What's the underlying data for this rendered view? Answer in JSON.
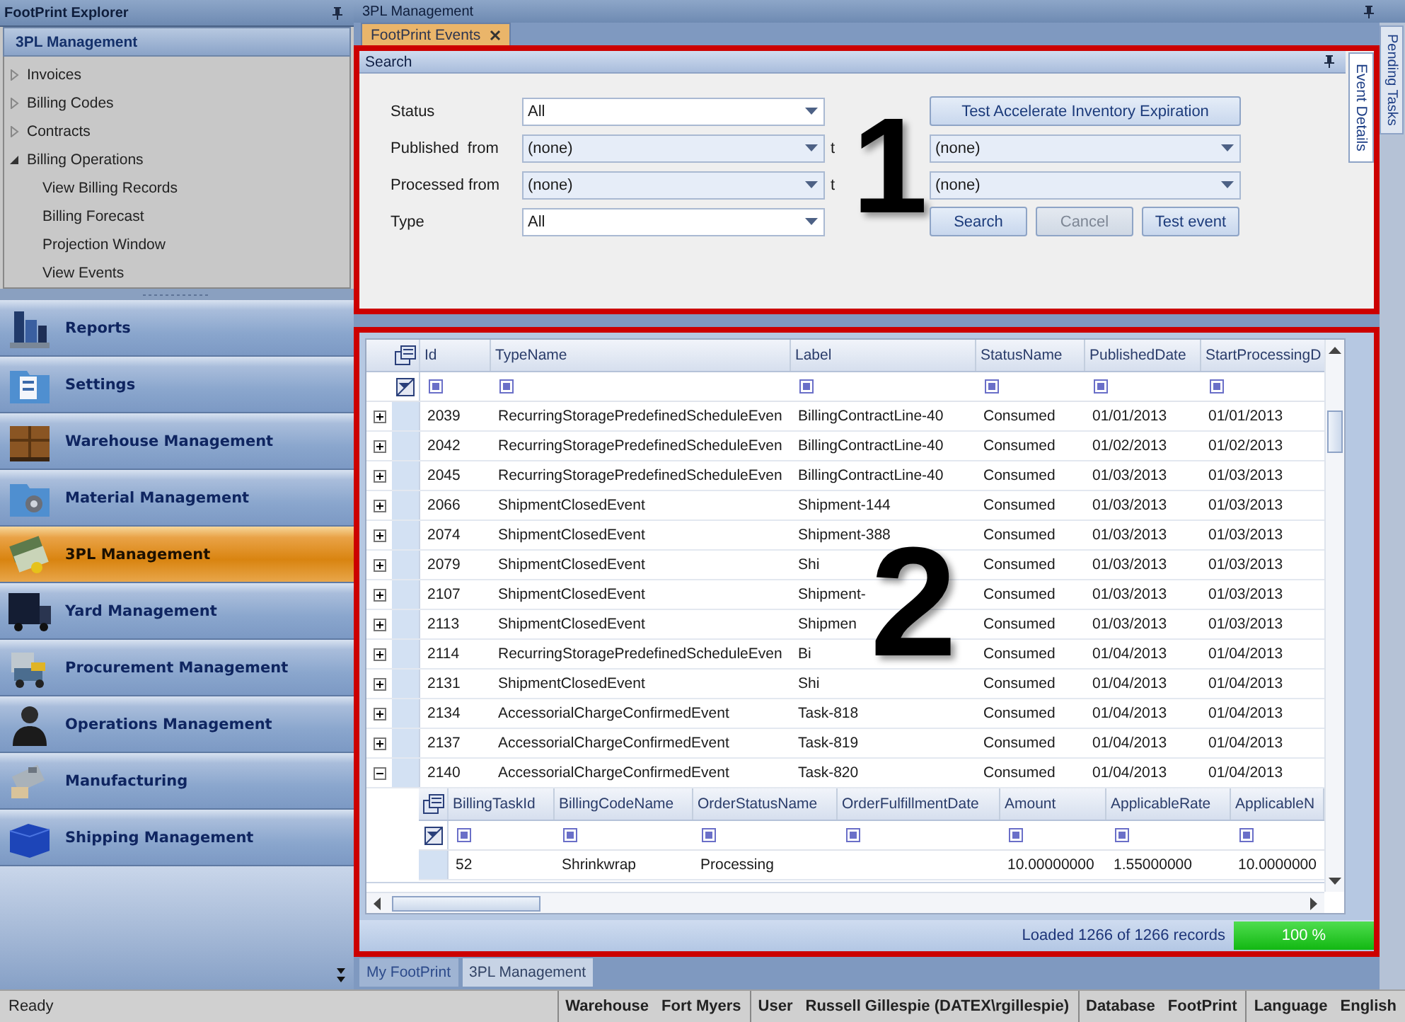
{
  "explorer": {
    "title": "FootPrint Explorer",
    "section": "3PL Management",
    "tree": [
      {
        "label": "Invoices",
        "expanded": false
      },
      {
        "label": "Billing Codes",
        "expanded": false
      },
      {
        "label": "Contracts",
        "expanded": false
      },
      {
        "label": "Billing Operations",
        "expanded": true,
        "children": [
          {
            "label": "View Billing Records"
          },
          {
            "label": "Billing Forecast"
          },
          {
            "label": "Projection Window"
          },
          {
            "label": "View Events"
          }
        ]
      }
    ]
  },
  "nav": [
    {
      "label": "Reports",
      "selected": false
    },
    {
      "label": "Settings",
      "selected": false
    },
    {
      "label": "Warehouse Management",
      "selected": false
    },
    {
      "label": "Material Management",
      "selected": false
    },
    {
      "label": "3PL Management",
      "selected": true
    },
    {
      "label": "Yard Management",
      "selected": false
    },
    {
      "label": "Procurement Management",
      "selected": false
    },
    {
      "label": "Operations Management",
      "selected": false
    },
    {
      "label": "Manufacturing",
      "selected": false
    },
    {
      "label": "Shipping Management",
      "selected": false
    }
  ],
  "document": {
    "title": "3PL Management",
    "tabs": [
      {
        "label": "FootPrint Events",
        "selected": true,
        "closable": true
      }
    ]
  },
  "side_tab": "Pending Tasks",
  "panel_tab": "Event Details",
  "search": {
    "title": "Search",
    "status": {
      "label": "Status",
      "value": "All"
    },
    "published": {
      "label": "Published  from",
      "from": "(none)",
      "to_label": "t",
      "to": "(none)"
    },
    "processed": {
      "label": "Processed from",
      "from": "(none)",
      "to_label": "t",
      "to": "(none)"
    },
    "type": {
      "label": "Type",
      "value": "All"
    },
    "test_button": {
      "label": "Test Accelerate Inventory Expiration",
      "disabled": false
    },
    "buttons": [
      {
        "label": "Search",
        "disabled": false
      },
      {
        "label": "Cancel",
        "disabled": true
      },
      {
        "label": "Test event",
        "disabled": false
      }
    ]
  },
  "callouts": [
    "1",
    "2"
  ],
  "grid": {
    "columns": [
      "Id",
      "TypeName",
      "Label",
      "StatusName",
      "PublishedDate",
      "StartProcessingD"
    ],
    "rows": [
      {
        "expanded": false,
        "cells": [
          "2039",
          "RecurringStoragePredefinedScheduleEven",
          "BillingContractLine-40",
          "Consumed",
          "01/01/2013",
          "01/01/2013"
        ]
      },
      {
        "expanded": false,
        "cells": [
          "2042",
          "RecurringStoragePredefinedScheduleEven",
          "BillingContractLine-40",
          "Consumed",
          "01/02/2013",
          "01/02/2013"
        ]
      },
      {
        "expanded": false,
        "cells": [
          "2045",
          "RecurringStoragePredefinedScheduleEven",
          "BillingContractLine-40",
          "Consumed",
          "01/03/2013",
          "01/03/2013"
        ]
      },
      {
        "expanded": false,
        "cells": [
          "2066",
          "ShipmentClosedEvent",
          "Shipment-144",
          "Consumed",
          "01/03/2013",
          "01/03/2013"
        ]
      },
      {
        "expanded": false,
        "cells": [
          "2074",
          "ShipmentClosedEvent",
          "Shipment-388",
          "Consumed",
          "01/03/2013",
          "01/03/2013"
        ]
      },
      {
        "expanded": false,
        "cells": [
          "2079",
          "ShipmentClosedEvent",
          "Shi",
          "Consumed",
          "01/03/2013",
          "01/03/2013"
        ]
      },
      {
        "expanded": false,
        "cells": [
          "2107",
          "ShipmentClosedEvent",
          "Shipment-",
          "Consumed",
          "01/03/2013",
          "01/03/2013"
        ]
      },
      {
        "expanded": false,
        "cells": [
          "2113",
          "ShipmentClosedEvent",
          "Shipmen",
          "Consumed",
          "01/03/2013",
          "01/03/2013"
        ]
      },
      {
        "expanded": false,
        "cells": [
          "2114",
          "RecurringStoragePredefinedScheduleEven",
          "Bi",
          "Consumed",
          "01/04/2013",
          "01/04/2013"
        ]
      },
      {
        "expanded": false,
        "cells": [
          "2131",
          "ShipmentClosedEvent",
          "Shi",
          "Consumed",
          "01/04/2013",
          "01/04/2013"
        ]
      },
      {
        "expanded": false,
        "cells": [
          "2134",
          "AccessorialChargeConfirmedEvent",
          "Task-818",
          "Consumed",
          "01/04/2013",
          "01/04/2013"
        ]
      },
      {
        "expanded": false,
        "cells": [
          "2137",
          "AccessorialChargeConfirmedEvent",
          "Task-819",
          "Consumed",
          "01/04/2013",
          "01/04/2013"
        ]
      },
      {
        "expanded": true,
        "cells": [
          "2140",
          "AccessorialChargeConfirmedEvent",
          "Task-820",
          "Consumed",
          "01/04/2013",
          "01/04/2013"
        ]
      }
    ],
    "detail": {
      "columns": [
        "BillingTaskId",
        "BillingCodeName",
        "OrderStatusName",
        "OrderFulfillmentDate",
        "Amount",
        "ApplicableRate",
        "ApplicableN"
      ],
      "rows": [
        [
          "52",
          "Shrinkwrap",
          "Processing",
          "",
          "10.00000000",
          "1.55000000",
          "10.0000000"
        ]
      ]
    },
    "status": "Loaded 1266 of 1266 records",
    "progress": {
      "level": 1,
      "label": "100 %"
    }
  },
  "bottom_tabs": [
    {
      "label": "My FootPrint",
      "selected": false
    },
    {
      "label": "3PL Management",
      "selected": true
    }
  ],
  "status_bar": {
    "text": "Ready",
    "fields": [
      {
        "label": "Warehouse",
        "value": "Fort Myers"
      },
      {
        "label": "User",
        "value": "Russell Gillespie (DATEX\\rgillespie)"
      },
      {
        "label": "Database",
        "value": "FootPrint"
      },
      {
        "label": "Language",
        "value": "English"
      }
    ]
  }
}
